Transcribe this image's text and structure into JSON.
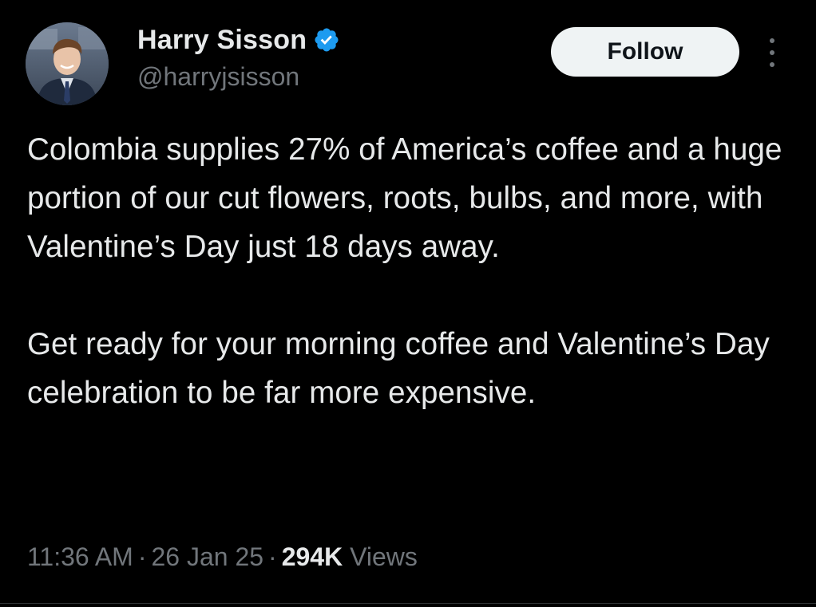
{
  "author": {
    "display_name": "Harry Sisson",
    "handle": "@harryjsisson",
    "verified": true,
    "verified_color": "#1d9bf0"
  },
  "actions": {
    "follow_label": "Follow",
    "more_icon": "more-vertical-icon"
  },
  "tweet": {
    "paragraphs": [
      "Colombia supplies 27% of America’s coffee and a huge portion of our cut flowers, roots, bulbs, and more, with Valentine’s Day just 18 days away.",
      "Get ready for your morning coffee and Valentine’s Day celebration to be far more expensive."
    ]
  },
  "meta": {
    "time": "11:36 AM",
    "separator": "·",
    "date": "26 Jan 25",
    "views_count": "294K",
    "views_label": "Views"
  },
  "colors": {
    "background": "#000000",
    "text_primary": "#e7e9ea",
    "text_secondary": "#71767b",
    "follow_bg": "#eff3f4"
  }
}
